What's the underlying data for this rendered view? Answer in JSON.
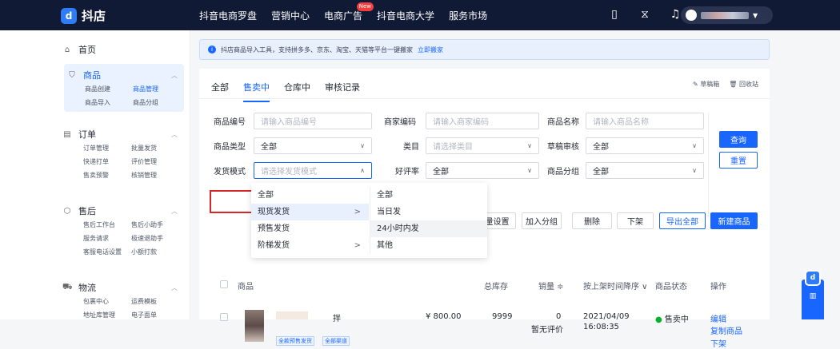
{
  "app": {
    "logo_text": "抖店"
  },
  "topnav": [
    {
      "label": "抖音电商罗盘"
    },
    {
      "label": "营销中心"
    },
    {
      "label": "电商广告",
      "badge": "New"
    },
    {
      "label": "抖音电商大学"
    },
    {
      "label": "服务市场"
    }
  ],
  "sidebar": {
    "home": "首页",
    "goods": {
      "title": "商品",
      "items": [
        "商品创建",
        "商品管理",
        "商品导入",
        "商品分组"
      ],
      "current": "商品管理"
    },
    "order": {
      "title": "订单",
      "items": [
        "订单管理",
        "批量发货",
        "快递打单",
        "评价管理",
        "售卖预警",
        "核销管理"
      ]
    },
    "aftersale": {
      "title": "售后",
      "items": [
        "售后工作台",
        "售后小助手",
        "服务请求",
        "极速退助手",
        "客服电话设置",
        "小额打款"
      ]
    },
    "logistics": {
      "title": "物流",
      "items": [
        "包裹中心",
        "运费模板",
        "地址库管理",
        "电子面单"
      ]
    }
  },
  "notice": {
    "text": "抖店商品导入工具，支持拼多多、京东、淘宝、天猫等平台一键搬家",
    "link": "立即搬家"
  },
  "tabs": [
    "全部",
    "售卖中",
    "仓库中",
    "审核记录"
  ],
  "tab_actions": {
    "draft": "草稿箱",
    "recycle": "回收站"
  },
  "filters": {
    "goods_code": {
      "label": "商品编号",
      "placeholder": "请输入商品编号"
    },
    "merchant_code": {
      "label": "商家编码",
      "placeholder": "请输入商家编码"
    },
    "goods_name": {
      "label": "商品名称",
      "placeholder": "请输入商品名称"
    },
    "goods_type": {
      "label": "商品类型",
      "value": "全部"
    },
    "category": {
      "label": "类目",
      "placeholder": "请选择类目"
    },
    "draft_review": {
      "label": "草稿审核",
      "value": "全部"
    },
    "ship_mode": {
      "label": "发货模式",
      "placeholder": "请选择发货模式"
    },
    "good_rate": {
      "label": "好评率",
      "value": "全部"
    },
    "group": {
      "label": "商品分组",
      "value": "全部"
    }
  },
  "buttons": {
    "query": "查询",
    "reset": "重置",
    "batch_set": "量设置",
    "add_group": "加入分组",
    "delete": "删除",
    "off_shelf": "下架",
    "export_all": "导出全部",
    "new_goods": "新建商品"
  },
  "dropdown": {
    "col1": [
      {
        "label": "全部"
      },
      {
        "label": "现货发货",
        "arrow": ">"
      },
      {
        "label": "预售发货"
      },
      {
        "label": "阶梯发货",
        "arrow": ">"
      }
    ],
    "col2": [
      "全部",
      "当日发",
      "24小时内发",
      "其他"
    ]
  },
  "table": {
    "headers": {
      "goods": "商品",
      "total_stock": "总库存",
      "sales": "销量 ≑",
      "time": "按上架时间降序 ∨",
      "status": "商品状态",
      "ops": "操作"
    },
    "row": {
      "title_tail": "拌",
      "tags": [
        "全款预售发货",
        "全部渠道"
      ],
      "price": "¥ 800.00",
      "stock": "9999",
      "sales": "0",
      "review": "暂无评价",
      "date": "2021/04/09",
      "time": "16:08:35",
      "status": "售卖中",
      "ops": [
        "编辑",
        "复制商品",
        "下架"
      ]
    }
  },
  "colors": {
    "accent": "#1966ff",
    "topbar": "#111a34",
    "highlight": "#d62626",
    "status_dot": "#00b42a"
  }
}
